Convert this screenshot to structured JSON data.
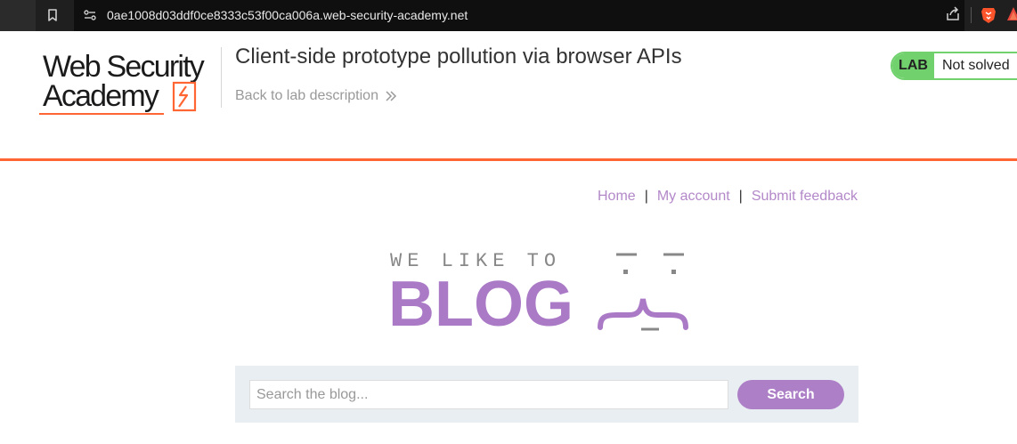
{
  "browser": {
    "url": "0ae1008d03ddf0ce8333c53f00ca006a.web-security-academy.net",
    "icons": [
      "bookmark-icon",
      "site-info-icon",
      "share-icon",
      "brave-lion-icon",
      "brave-rewards-icon"
    ]
  },
  "academy_header": {
    "logo_line1": "Web Security",
    "logo_line2": "Academy",
    "lab_title": "Client-side prototype pollution via browser APIs",
    "back_link": "Back to lab description",
    "status_label": "LAB",
    "status_text": "Not solved"
  },
  "blog": {
    "nav": {
      "home": "Home",
      "separator": "|",
      "my_account": "My account",
      "submit_feedback": "Submit feedback"
    },
    "banner_small": "WE LIKE TO",
    "banner_big": "BLOG",
    "search": {
      "placeholder": "Search the blog...",
      "value": "",
      "button": "Search"
    }
  },
  "colors": {
    "accent_orange": "#ff6633",
    "status_green": "#70d16d",
    "blog_purple": "#aa7ac6",
    "search_panel": "#e9eef2"
  }
}
